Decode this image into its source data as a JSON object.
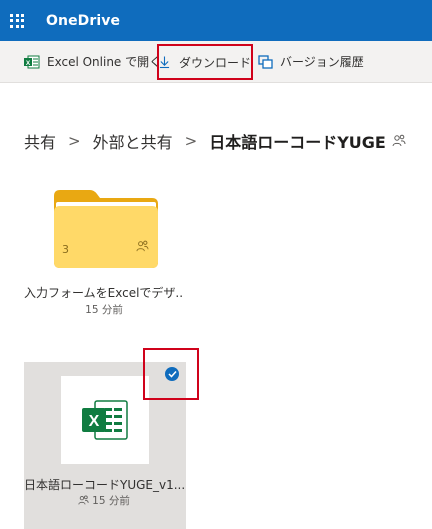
{
  "app": {
    "title": "OneDrive"
  },
  "commandbar": {
    "open_label": "Excel Online で開く",
    "download_label": "ダウンロード",
    "version_label": "バージョン履歴"
  },
  "breadcrumb": {
    "items": [
      "共有",
      "外部と共有"
    ],
    "current": "日本語ローコードYUGE",
    "separator": ">"
  },
  "folder": {
    "name": "入力フォームをExcelでデザ...",
    "count": "3",
    "modified": "15 分前"
  },
  "file": {
    "name": "日本語ローコードYUGE_v1...",
    "modified": "15 分前",
    "selected": true
  },
  "colors": {
    "brand": "#0f6cbd",
    "excel": "#107c41",
    "highlight": "#d0021b",
    "folder": "#ffd968"
  },
  "icons": [
    "app-launcher-icon",
    "excel-icon",
    "download-icon",
    "version-history-icon",
    "shared-people-icon",
    "folder-icon",
    "checkmark-icon"
  ]
}
